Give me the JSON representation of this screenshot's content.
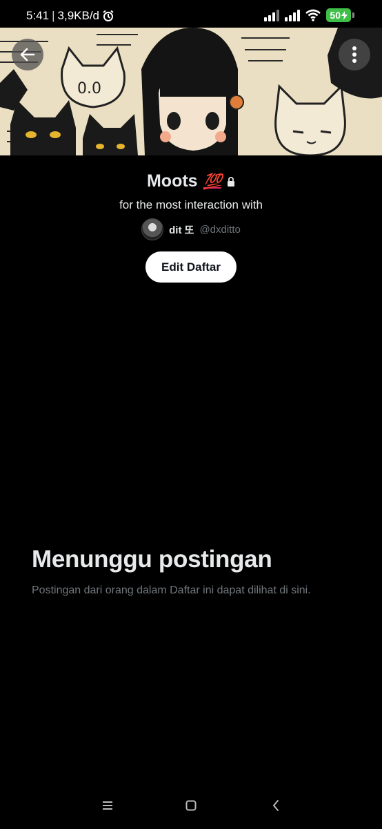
{
  "status_bar": {
    "time": "5:41",
    "network_speed": "3,9KB/d",
    "battery": "50"
  },
  "list": {
    "name": "Moots",
    "emoji": "💯",
    "description": "for the most interaction with",
    "owner_name": "dit 또",
    "owner_handle": "@dxditto",
    "edit_label": "Edit Daftar"
  },
  "empty_state": {
    "title": "Menunggu postingan",
    "subtitle": "Postingan dari orang dalam Daftar ini dapat dilihat di sini."
  },
  "icons": {
    "back": "back-arrow-icon",
    "more": "more-vertical-icon",
    "lock": "lock-icon",
    "alarm": "alarm-icon",
    "wifi": "wifi-icon"
  },
  "colors": {
    "background": "#000000",
    "text_primary": "#e7e9ea",
    "text_secondary": "#71767b",
    "button_bg": "#ffffff",
    "battery": "#3fbf4a"
  }
}
